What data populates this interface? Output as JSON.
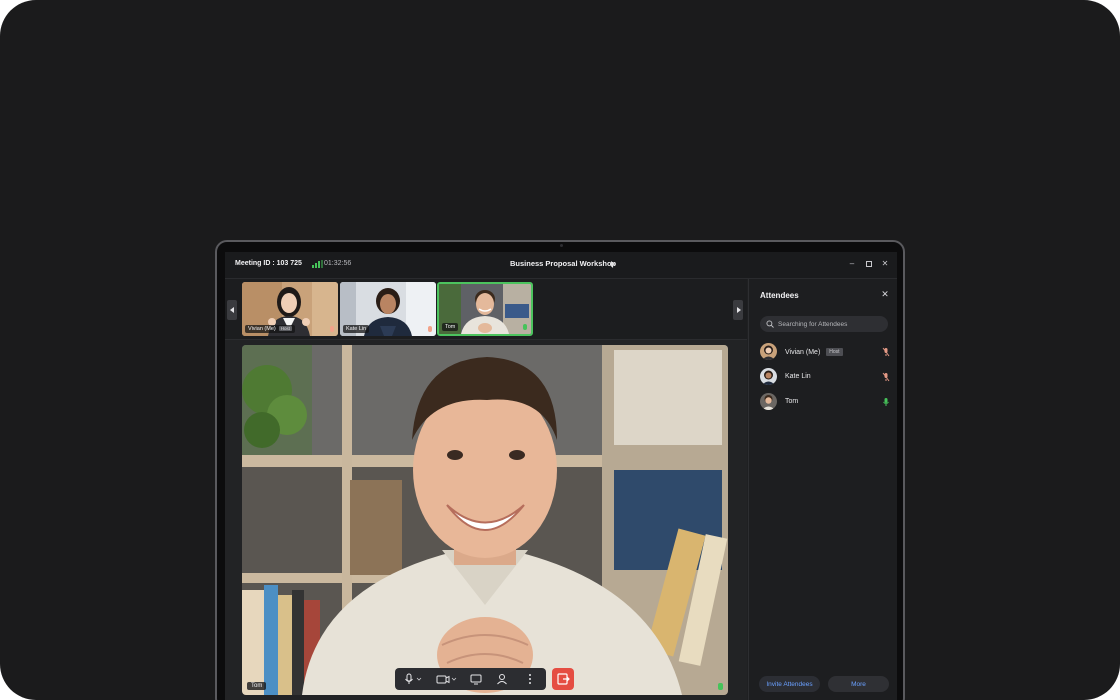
{
  "meeting": {
    "id_label": "Meeting ID : 103 725",
    "elapsed": "01:32:56",
    "title": "Business Proposal Workshop",
    "signal_color": "#46c35a"
  },
  "window_controls": [
    "minimize-icon",
    "maximize-icon",
    "close-icon"
  ],
  "participants_strip": [
    {
      "name": "Vivian (Me)",
      "badge": "Host",
      "mic": "muted",
      "active": false
    },
    {
      "name": "Kate Lin",
      "badge": "",
      "mic": "muted",
      "active": false
    },
    {
      "name": "Tom",
      "badge": "",
      "mic": "on",
      "active": true
    }
  ],
  "active_speaker": {
    "name": "Tom",
    "mic": "on"
  },
  "toolbar": {
    "icons": [
      "microphone-icon",
      "camera-icon",
      "screen-share-icon",
      "participants-icon",
      "more-options-icon"
    ],
    "leave_icon": "leave-icon",
    "leave_color": "#e54d42"
  },
  "attendees_panel": {
    "title": "Attendees",
    "search_placeholder": "Searching for Attendees",
    "attendees": [
      {
        "name": "Vivian (Me)",
        "badge": "Host",
        "mic": "muted"
      },
      {
        "name": "Kate Lin",
        "badge": "",
        "mic": "muted"
      },
      {
        "name": "Tom",
        "badge": "",
        "mic": "on"
      }
    ],
    "invite_label": "Invite Attendees",
    "more_label": "More",
    "accent_color": "#6aa0ff"
  }
}
